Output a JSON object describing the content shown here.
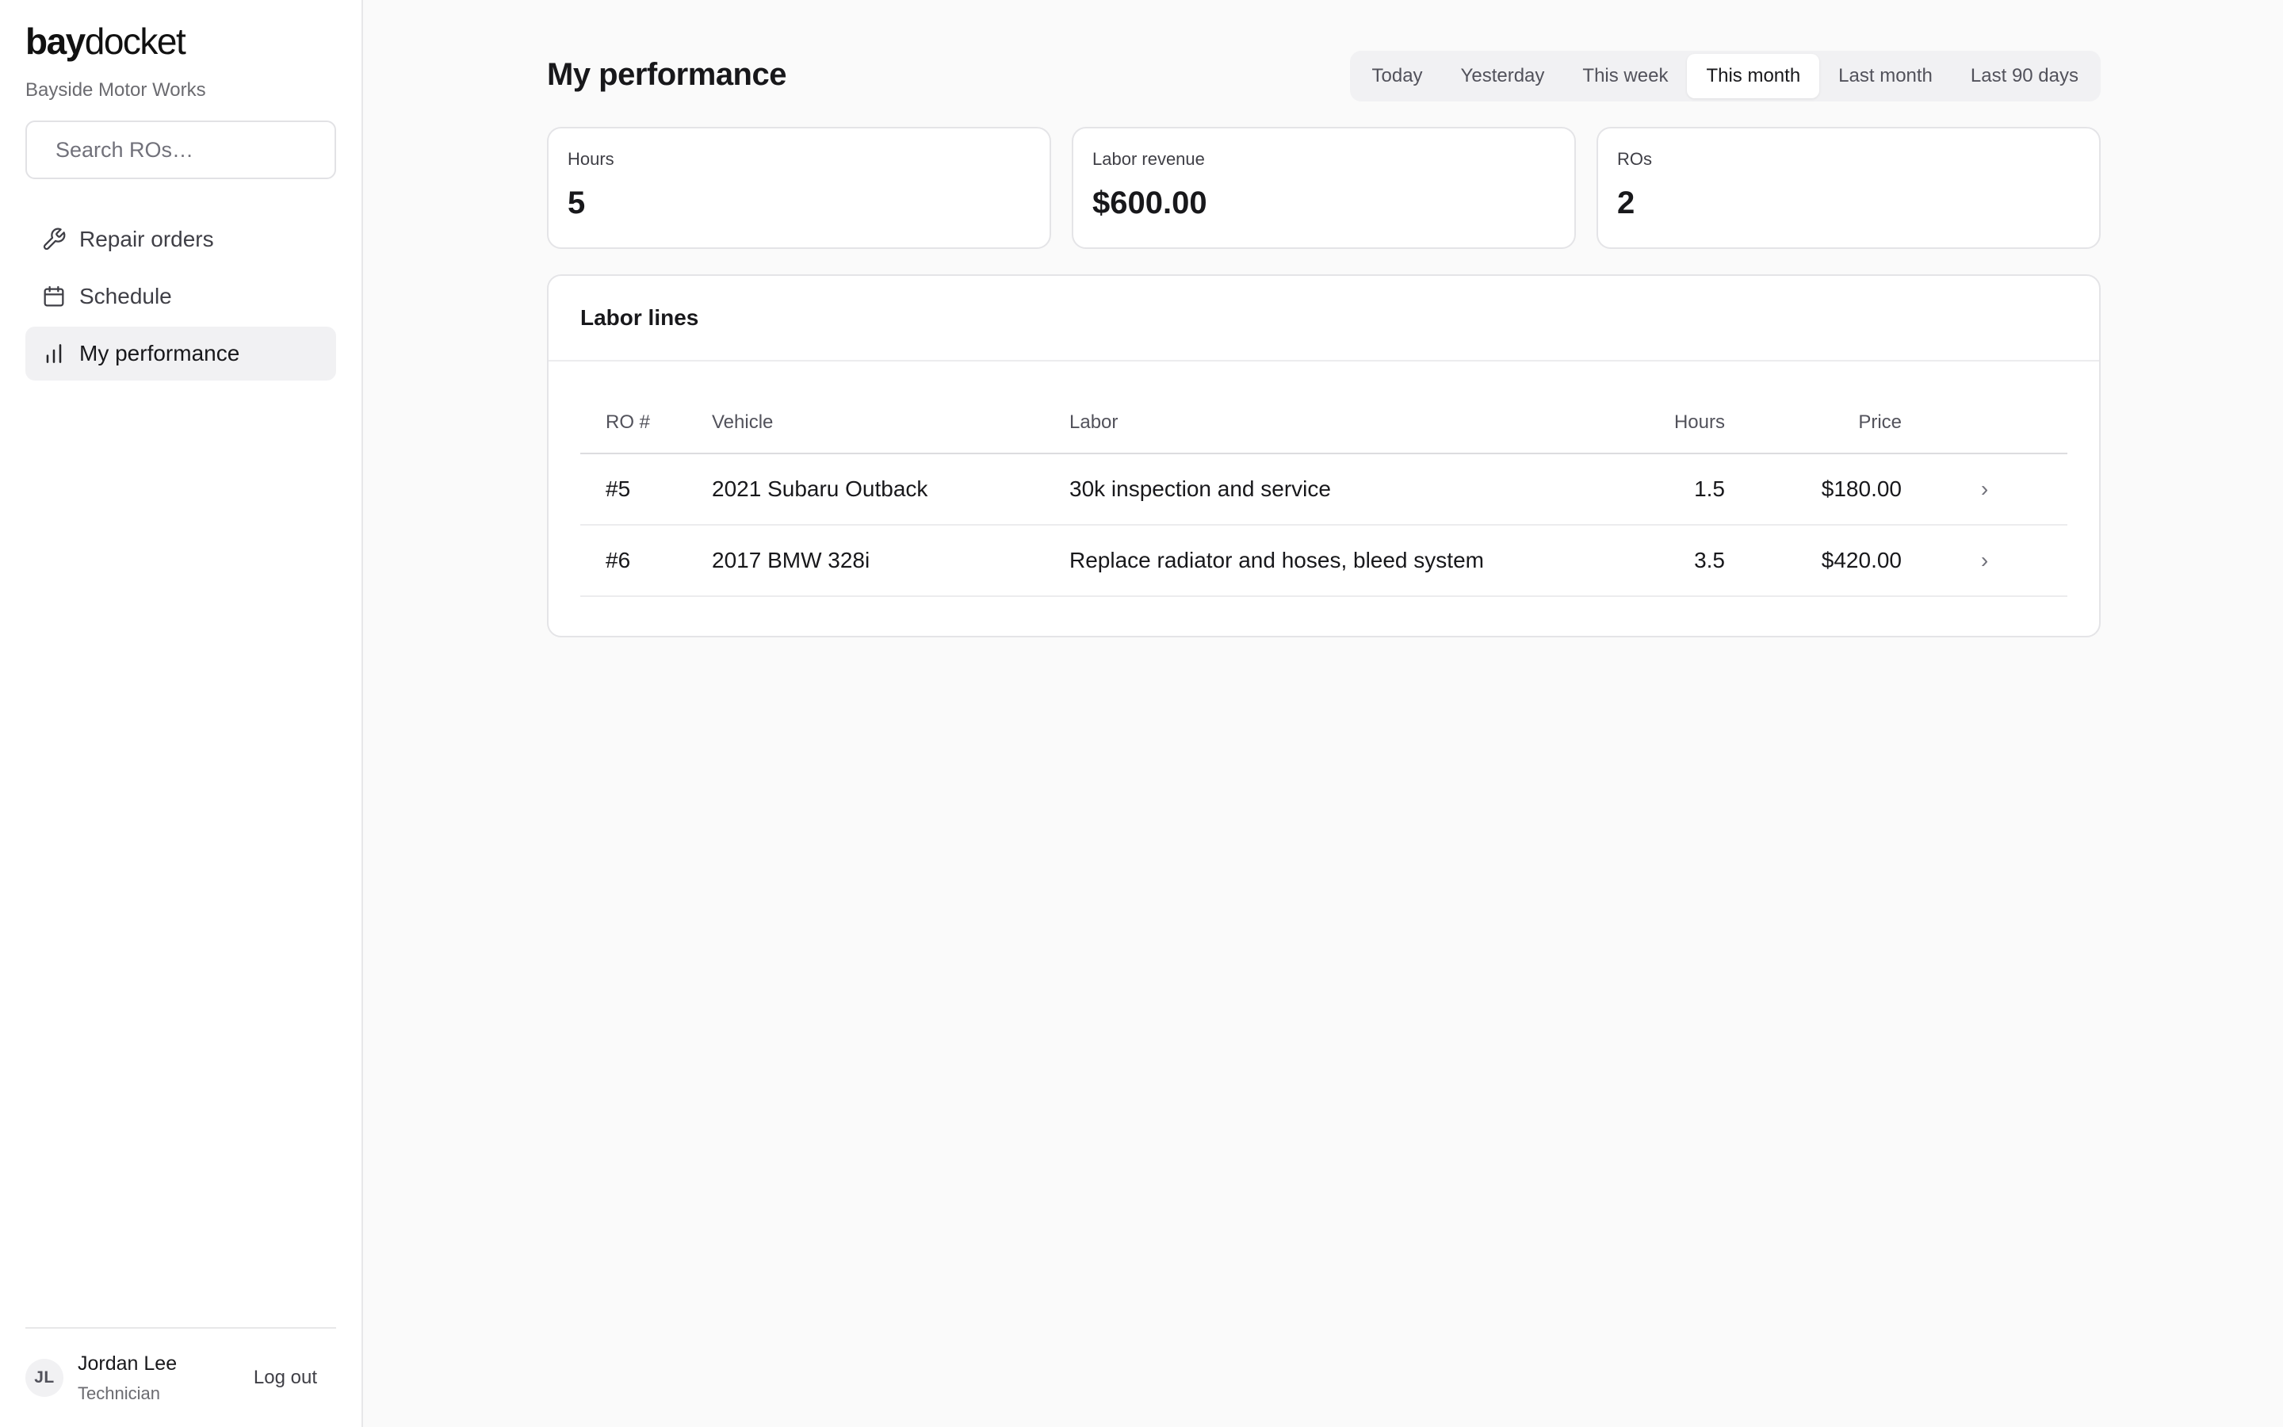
{
  "brand": {
    "bold": "bay",
    "light": "docket",
    "shop": "Bayside Motor Works"
  },
  "search": {
    "placeholder": "Search ROs…",
    "value": ""
  },
  "nav": [
    {
      "label": "Repair orders",
      "icon": "wrench-icon",
      "active": false
    },
    {
      "label": "Schedule",
      "icon": "calendar-icon",
      "active": false
    },
    {
      "label": "My performance",
      "icon": "bar-chart-icon",
      "active": true
    }
  ],
  "user": {
    "initials": "JL",
    "name": "Jordan Lee",
    "role": "Technician",
    "logout": "Log out"
  },
  "page": {
    "title": "My performance"
  },
  "ranges": [
    {
      "label": "Today",
      "active": false
    },
    {
      "label": "Yesterday",
      "active": false
    },
    {
      "label": "This week",
      "active": false
    },
    {
      "label": "This month",
      "active": true
    },
    {
      "label": "Last month",
      "active": false
    },
    {
      "label": "Last 90 days",
      "active": false
    }
  ],
  "stats": [
    {
      "label": "Hours",
      "value": "5"
    },
    {
      "label": "Labor revenue",
      "value": "$600.00"
    },
    {
      "label": "ROs",
      "value": "2"
    }
  ],
  "labor": {
    "title": "Labor lines",
    "columns": [
      "RO #",
      "Vehicle",
      "Labor",
      "Hours",
      "Price"
    ],
    "rows": [
      {
        "ro": "#5",
        "vehicle": "2021 Subaru Outback",
        "labor": "30k inspection and service",
        "hours": "1.5",
        "price": "$180.00",
        "chevron": "›"
      },
      {
        "ro": "#6",
        "vehicle": "2017 BMW 328i",
        "labor": "Replace radiator and hoses, bleed system",
        "hours": "3.5",
        "price": "$420.00",
        "chevron": "›"
      }
    ]
  },
  "colors": {
    "accent": "#18181b",
    "muted": "#71717a",
    "border": "#e4e4e7",
    "activeBg": "#f1f1f3"
  }
}
